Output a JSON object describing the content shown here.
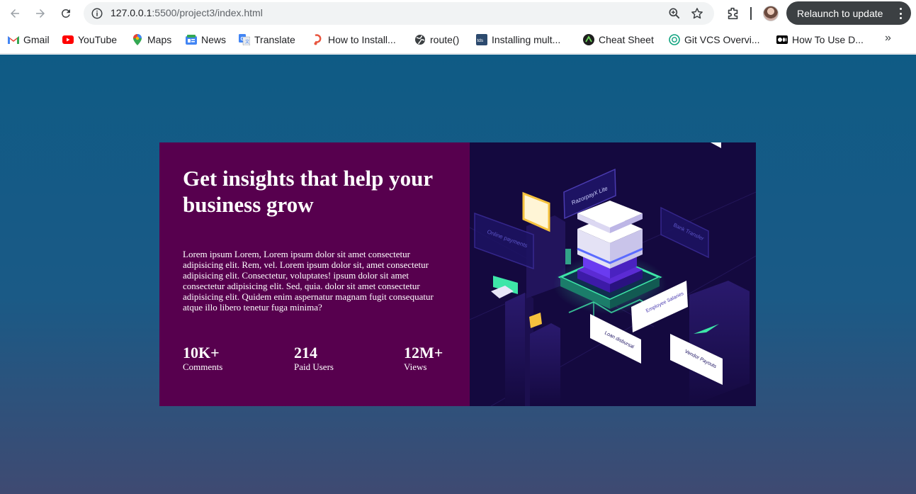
{
  "browser": {
    "url_host": "127.0.0.1",
    "url_rest": ":5500/project3/index.html",
    "relaunch_label": "Relaunch to update",
    "bookmarks": [
      {
        "label": "Gmail",
        "icon": "gmail-icon"
      },
      {
        "label": "YouTube",
        "icon": "youtube-icon"
      },
      {
        "label": "Maps",
        "icon": "maps-icon"
      },
      {
        "label": "News",
        "icon": "news-icon"
      },
      {
        "label": "Translate",
        "icon": "translate-icon"
      },
      {
        "label": "How to Install...",
        "icon": "install-icon"
      },
      {
        "label": "route()",
        "icon": "globe-icon"
      },
      {
        "label": "Installing mult...",
        "icon": "tds-icon"
      },
      {
        "label": "Cheat Sheet",
        "icon": "cheatsheet-icon"
      },
      {
        "label": "Git VCS Overvi...",
        "icon": "chatgpt-icon"
      },
      {
        "label": "How To Use D...",
        "icon": "medium-icon"
      }
    ],
    "more_bookmarks": "»"
  },
  "card": {
    "headline": "Get insights that help your business grow",
    "body": "Lorem ipsum Lorem, Lorem ipsum dolor sit amet consectetur adipisicing elit. Rem, vel. Lorem ipsum dolor sit, amet consectetur adipisicing elit. Consectetur, voluptates! ipsum dolor sit amet consectetur adipisicing elit. Sed, quia. dolor sit amet consectetur adipisicing elit. Quidem enim aspernatur magnam fugit consequatur atque illo libero tenetur fuga minima?",
    "stats": [
      {
        "value": "10K+",
        "label": "Comments"
      },
      {
        "value": "214",
        "label": "Paid Users"
      },
      {
        "value": "12M+",
        "label": "Views"
      }
    ]
  },
  "illustration": {
    "labels": {
      "razorpay": "RazorpayX Lite",
      "online_payments": "Online payments",
      "bank_transfer": "Bank Transfer",
      "employee_salaries": "Employee Salaries",
      "loan_disbursal": "Loan disbursal",
      "vendor_payouts": "Vendor Payouts"
    }
  },
  "colors": {
    "card_left_bg": "#57004e",
    "card_right_bg": "#14093f",
    "accent_green": "#3ee6a8"
  }
}
